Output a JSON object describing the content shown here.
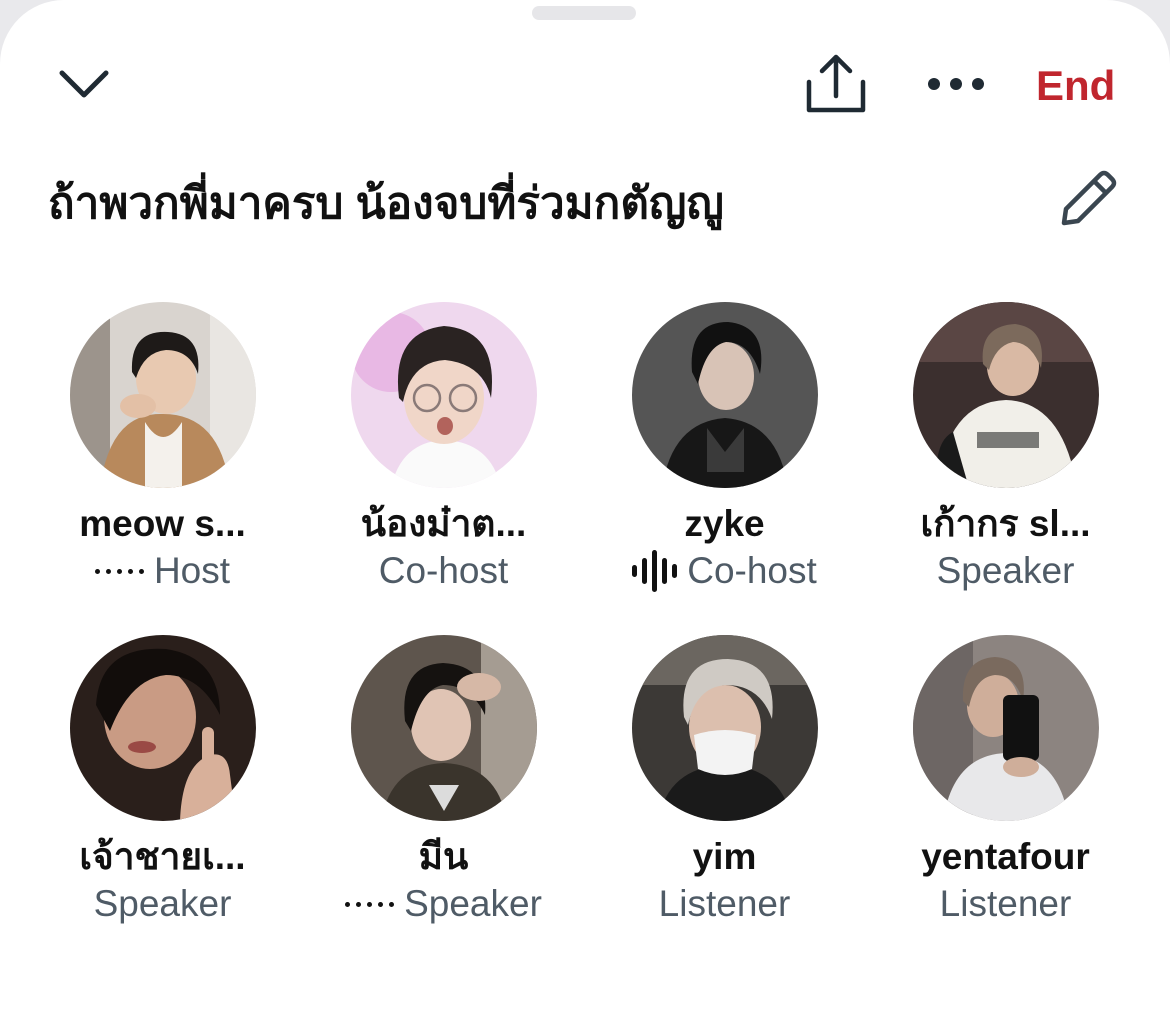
{
  "header": {
    "collapse_icon": "chevron-down-icon",
    "share_icon": "share-upload-icon",
    "more_icon": "more-horizontal-icon",
    "end_label": "End",
    "end_color": "#c0262e"
  },
  "space": {
    "title": "ถ้าพวกพี่มาครบ น้องจบที่ร่วมกตัญญู",
    "edit_icon": "pencil-icon"
  },
  "participants": [
    {
      "name": "meow s...",
      "role": "Host",
      "indicator": "dots"
    },
    {
      "name": "น้องม๋าต...",
      "role": "Co-host",
      "indicator": "none"
    },
    {
      "name": "zyke",
      "role": "Co-host",
      "indicator": "speaking"
    },
    {
      "name": "เก้ากร sl...",
      "role": "Speaker",
      "indicator": "none"
    },
    {
      "name": "เจ้าชายเ...",
      "role": "Speaker",
      "indicator": "none"
    },
    {
      "name": "มีน",
      "role": "Speaker",
      "indicator": "dots"
    },
    {
      "name": "yim",
      "role": "Listener",
      "indicator": "none"
    },
    {
      "name": "yentafour",
      "role": "Listener",
      "indicator": "none"
    }
  ],
  "colors": {
    "text_primary": "#111111",
    "text_secondary": "#4f5b66",
    "icon": "#1f2a33"
  }
}
